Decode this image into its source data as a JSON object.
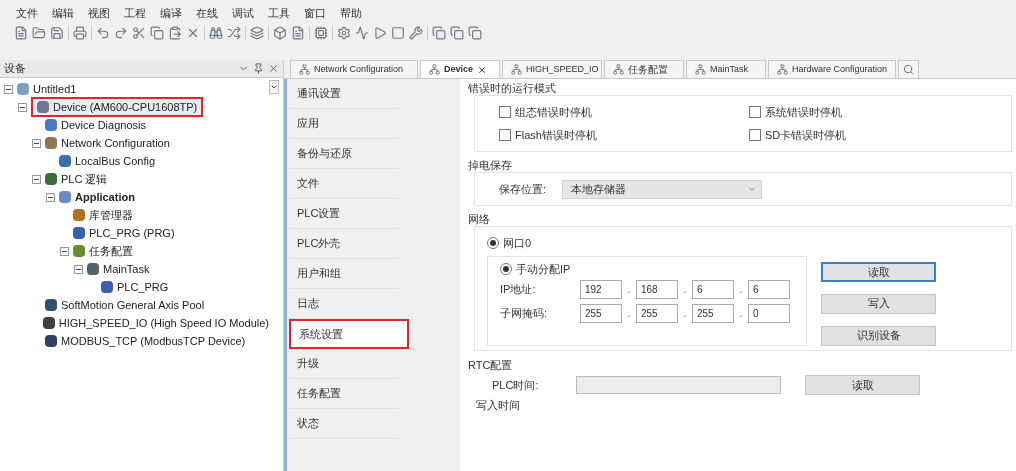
{
  "menu": [
    "文件",
    "编辑",
    "视图",
    "工程",
    "编译",
    "在线",
    "调试",
    "工具",
    "窗口",
    "帮助"
  ],
  "devices_panel": {
    "title": "设备",
    "tree": [
      {
        "label": "Untitled1",
        "kind": "project",
        "expanded": true,
        "highlighted": false,
        "bold": false,
        "children": [
          {
            "label": "Device (AM600-CPU1608TP)",
            "kind": "device",
            "expanded": true,
            "highlighted": true,
            "bold": false,
            "children": [
              {
                "label": "Device Diagnosis",
                "kind": "diag",
                "highlighted": false,
                "bold": false
              },
              {
                "label": "Network Configuration",
                "kind": "network",
                "expanded": true,
                "highlighted": false,
                "bold": false,
                "children": [
                  {
                    "label": "LocalBus Config",
                    "kind": "bus",
                    "highlighted": false,
                    "bold": false
                  }
                ]
              },
              {
                "label": "PLC 逻辑",
                "kind": "plc",
                "expanded": true,
                "highlighted": false,
                "bold": false,
                "children": [
                  {
                    "label": "Application",
                    "kind": "app",
                    "expanded": true,
                    "highlighted": false,
                    "bold": true,
                    "children": [
                      {
                        "label": "库管理器",
                        "kind": "lib",
                        "highlighted": false,
                        "bold": false
                      },
                      {
                        "label": "PLC_PRG (PRG)",
                        "kind": "prg",
                        "highlighted": false,
                        "bold": false
                      },
                      {
                        "label": "任务配置",
                        "kind": "task",
                        "expanded": true,
                        "highlighted": false,
                        "bold": false,
                        "children": [
                          {
                            "label": "MainTask",
                            "kind": "maintask",
                            "expanded": true,
                            "highlighted": false,
                            "bold": false,
                            "children": [
                              {
                                "label": "PLC_PRG",
                                "kind": "prg",
                                "highlighted": false,
                                "bold": false
                              }
                            ]
                          }
                        ]
                      }
                    ]
                  }
                ]
              },
              {
                "label": "SoftMotion General Axis Pool",
                "kind": "axis",
                "highlighted": false,
                "bold": false
              },
              {
                "label": "HIGH_SPEED_IO (High Speed IO Module)",
                "kind": "module",
                "highlighted": false,
                "bold": false
              },
              {
                "label": "MODBUS_TCP (ModbusTCP Device)",
                "kind": "modbus",
                "highlighted": false,
                "bold": false
              }
            ]
          }
        ]
      }
    ]
  },
  "tabs": [
    {
      "label": "Network Configuration",
      "selected": false
    },
    {
      "label": "Device",
      "selected": true
    },
    {
      "label": "HIGH_SPEED_IO",
      "selected": false
    },
    {
      "label": "任务配置",
      "selected": false
    },
    {
      "label": "MainTask",
      "selected": false
    },
    {
      "label": "Hardware Configuration",
      "selected": false
    }
  ],
  "nav": [
    {
      "label": "通讯设置",
      "selected": false,
      "highlighted": false
    },
    {
      "label": "应用",
      "selected": false,
      "highlighted": false
    },
    {
      "label": "备份与还原",
      "selected": false,
      "highlighted": false
    },
    {
      "label": "文件",
      "selected": false,
      "highlighted": false
    },
    {
      "label": "PLC设置",
      "selected": false,
      "highlighted": false
    },
    {
      "label": "PLC外壳",
      "selected": false,
      "highlighted": false
    },
    {
      "label": "用户和组",
      "selected": false,
      "highlighted": false
    },
    {
      "label": "日志",
      "selected": false,
      "highlighted": false
    },
    {
      "label": "系统设置",
      "selected": true,
      "highlighted": true
    },
    {
      "label": "升级",
      "selected": false,
      "highlighted": false
    },
    {
      "label": "任务配置",
      "selected": false,
      "highlighted": false
    },
    {
      "label": "状态",
      "selected": false,
      "highlighted": false
    }
  ],
  "error_mode": {
    "title": "错误时的运行模式",
    "options": [
      {
        "label": "组态错误时停机",
        "checked": false
      },
      {
        "label": "系统错误时停机",
        "checked": false
      },
      {
        "label": "Flash错误时停机",
        "checked": false
      },
      {
        "label": "SD卡错误时停机",
        "checked": false
      }
    ]
  },
  "power_save": {
    "title": "掉电保存",
    "label": "保存位置:",
    "value": "本地存储器"
  },
  "network": {
    "title": "网络",
    "port": {
      "label": "网口0",
      "selected": true
    },
    "manual": {
      "label": "手动分配IP",
      "selected": true
    },
    "ip": {
      "label": "IP地址:",
      "parts": [
        "192",
        "168",
        "6",
        "6"
      ]
    },
    "mask": {
      "label": "子网掩码:",
      "parts": [
        "255",
        "255",
        "255",
        "0"
      ]
    },
    "dot": ".",
    "buttons": [
      {
        "label": "读取",
        "focused": true
      },
      {
        "label": "写入",
        "focused": false
      },
      {
        "label": "识别设备",
        "focused": false
      }
    ]
  },
  "rtc": {
    "title": "RTC配置",
    "plc_time_label": "PLC时间:",
    "read_button": "读取",
    "write_time_label": "写入时间"
  }
}
